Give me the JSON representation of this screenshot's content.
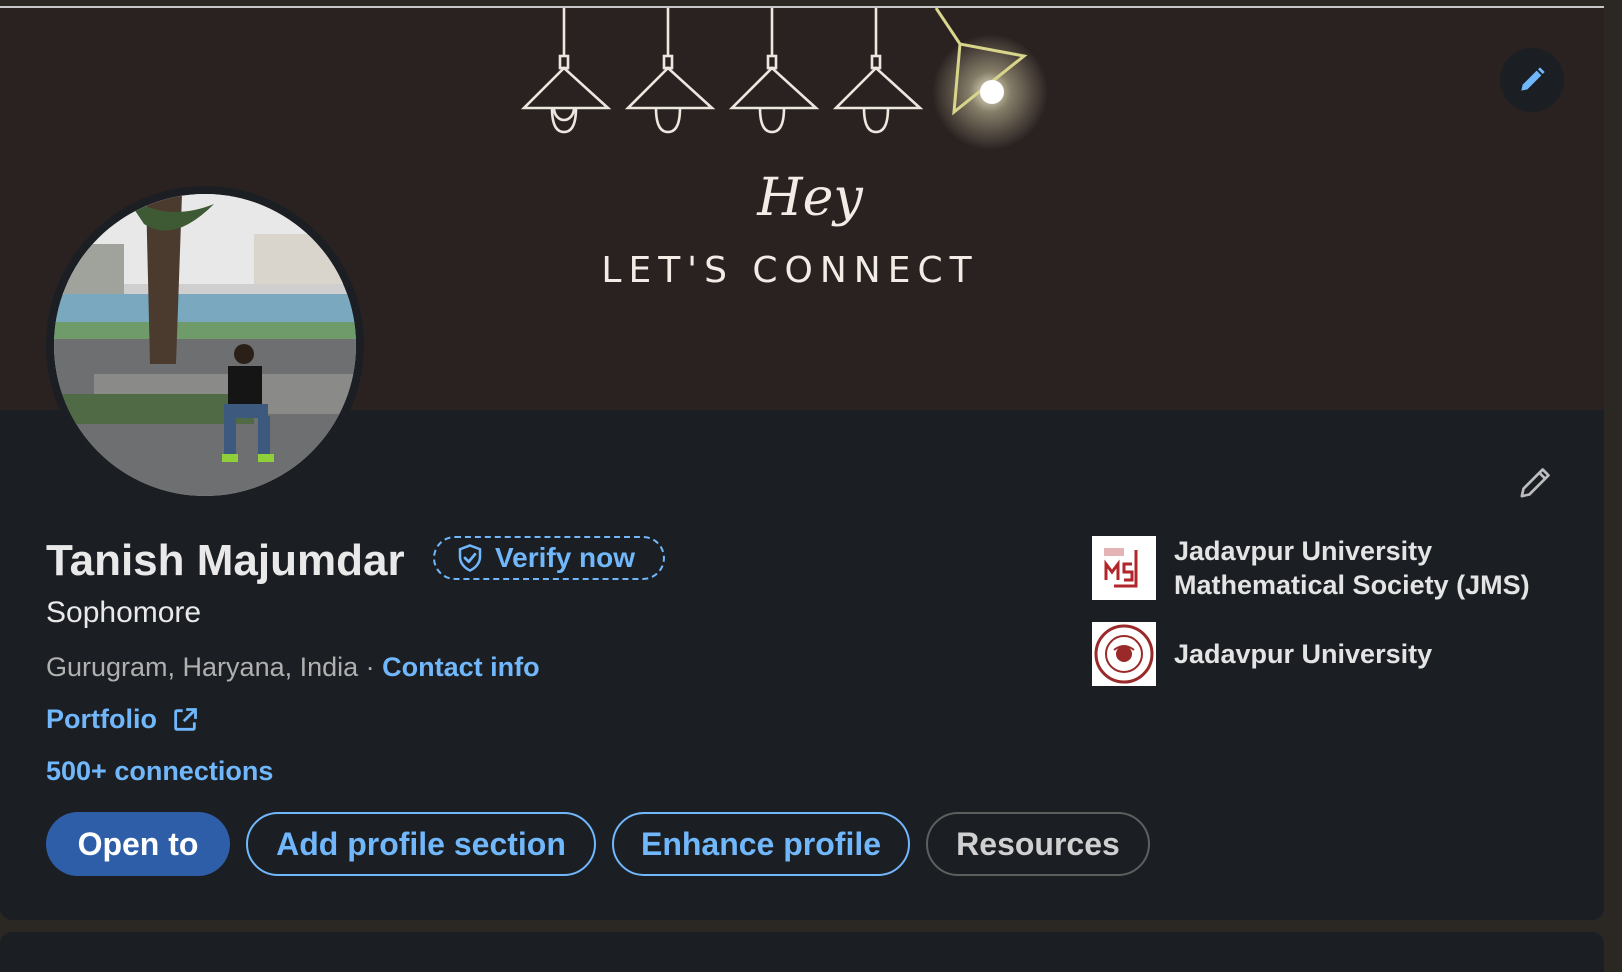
{
  "banner": {
    "script_text": "Hey",
    "tagline": "LET'S CONNECT"
  },
  "profile": {
    "name": "Tanish Majumdar",
    "verify_label": "Verify now",
    "headline": "Sophomore",
    "location": "Gurugram, Haryana, India",
    "separator": " · ",
    "contact_label": "Contact info",
    "portfolio_label": "Portfolio",
    "connections": "500+ connections"
  },
  "actions": {
    "open_to": "Open to",
    "add_section": "Add profile section",
    "enhance": "Enhance profile",
    "resources": "Resources"
  },
  "education": [
    {
      "line1": "Jadavpur University",
      "line2": "Mathematical Society (JMS)",
      "logo": "jms-logo"
    },
    {
      "line1": "Jadavpur University",
      "logo": "jadavpur-university-seal"
    }
  ],
  "colors": {
    "card_bg": "#1b1f23",
    "banner_bg": "#2a2221",
    "link": "#71b7fb",
    "primary_button": "#2f5ea8"
  },
  "icons": {
    "banner_edit": "pencil-icon",
    "intro_edit": "pencil-outline-icon",
    "verify": "shield-check-icon",
    "portfolio": "external-link-icon"
  }
}
